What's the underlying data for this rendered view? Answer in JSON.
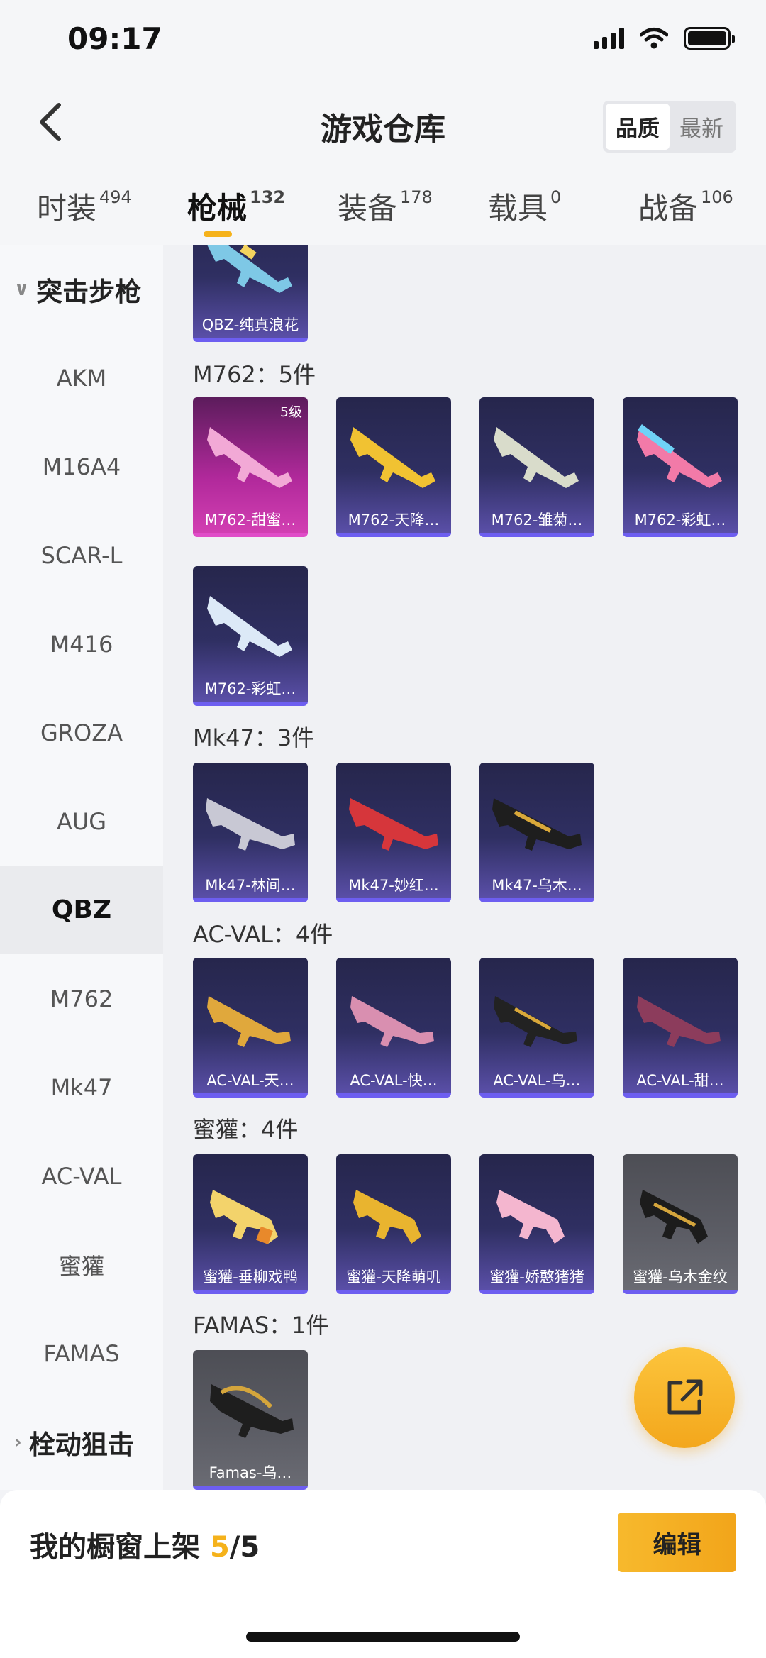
{
  "status": {
    "time": "09:17"
  },
  "header": {
    "title": "游戏仓库",
    "sort_options": [
      "品质",
      "最新"
    ],
    "sort_active": "品质"
  },
  "tabs": [
    {
      "label": "时装",
      "count": "494"
    },
    {
      "label": "枪械",
      "count": "132",
      "active": true
    },
    {
      "label": "装备",
      "count": "178"
    },
    {
      "label": "载具",
      "count": "0"
    },
    {
      "label": "战备",
      "count": "106"
    }
  ],
  "sidebar": {
    "group_top": "突击步枪",
    "items": [
      "AKM",
      "M16A4",
      "SCAR-L",
      "M416",
      "GROZA",
      "AUG",
      "QBZ",
      "M762",
      "Mk47",
      "AC-VAL",
      "蜜獾",
      "FAMAS"
    ],
    "active": "QBZ",
    "group_bottom": "栓动狙击"
  },
  "sections": [
    {
      "title": "",
      "cards": [
        {
          "name": "QBZ-纯真浪花"
        }
      ]
    },
    {
      "title": "M762：5件",
      "cards": [
        {
          "name": "M762-甜蜜…",
          "level": "5级"
        },
        {
          "name": "M762-天降…"
        },
        {
          "name": "M762-雏菊…"
        },
        {
          "name": "M762-彩虹…"
        },
        {
          "name": "M762-彩虹…"
        }
      ]
    },
    {
      "title": "Mk47：3件",
      "cards": [
        {
          "name": "Mk47-林间…"
        },
        {
          "name": "Mk47-妙红…"
        },
        {
          "name": "Mk47-乌木…"
        }
      ]
    },
    {
      "title": "AC-VAL：4件",
      "cards": [
        {
          "name": "AC-VAL-天…"
        },
        {
          "name": "AC-VAL-快…"
        },
        {
          "name": "AC-VAL-乌…"
        },
        {
          "name": "AC-VAL-甜…"
        }
      ]
    },
    {
      "title": "蜜獾：4件",
      "cards": [
        {
          "name": "蜜獾-垂柳戏鸭"
        },
        {
          "name": "蜜獾-天降萌叽"
        },
        {
          "name": "蜜獾-娇憨猪猪"
        },
        {
          "name": "蜜獾-乌木金纹"
        }
      ]
    },
    {
      "title": "FAMAS：1件",
      "cards": [
        {
          "name": "Famas-乌…"
        }
      ]
    }
  ],
  "bottom": {
    "label": "我的橱窗上架",
    "current": "5",
    "total": "/5",
    "edit_label": "编辑"
  },
  "colors": {
    "accent": "#f5b21b"
  },
  "icons": {
    "fab": "share-external-icon",
    "back": "chevron-left-icon"
  }
}
